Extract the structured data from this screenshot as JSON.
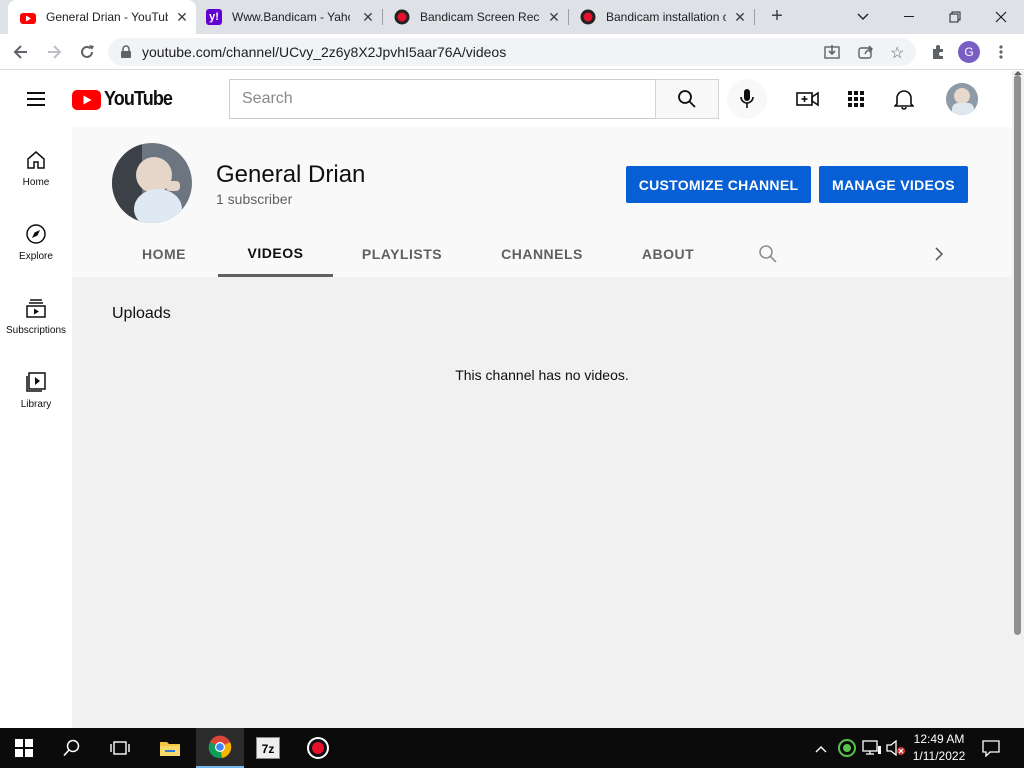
{
  "browser": {
    "tabs": [
      {
        "title": "General Drian - YouTube",
        "favicon": "youtube-icon",
        "active": true
      },
      {
        "title": "Www.Bandicam - Yahoo",
        "favicon": "yahoo-icon",
        "active": false
      },
      {
        "title": "Bandicam Screen Recorder",
        "favicon": "bandicam-icon",
        "active": false
      },
      {
        "title": "Bandicam installation c",
        "favicon": "bandicam-icon",
        "active": false
      }
    ],
    "url": "youtube.com/channel/UCvy_2z6y8X2JpvhI5aar76A/videos",
    "profile_initial": "G"
  },
  "youtube": {
    "logo_text": "YouTube",
    "search_placeholder": "Search",
    "sidebar": [
      {
        "label": "Home",
        "icon": "home-icon"
      },
      {
        "label": "Explore",
        "icon": "compass-icon"
      },
      {
        "label": "Subscriptions",
        "icon": "subscriptions-icon"
      },
      {
        "label": "Library",
        "icon": "library-icon"
      }
    ],
    "channel": {
      "name": "General Drian",
      "subscribers": "1 subscriber",
      "customize_label": "CUSTOMIZE CHANNEL",
      "manage_label": "MANAGE VIDEOS",
      "tabs": [
        "HOME",
        "VIDEOS",
        "PLAYLISTS",
        "CHANNELS",
        "ABOUT"
      ],
      "active_tab": "VIDEOS"
    },
    "uploads_title": "Uploads",
    "empty_message": "This channel has no videos."
  },
  "taskbar": {
    "time": "12:49 AM",
    "date": "1/11/2022",
    "sevenzip_label": "7z"
  },
  "colors": {
    "accent_blue": "#065fd4",
    "youtube_red": "#ff0000",
    "tab_bar": "#dee1e6"
  }
}
